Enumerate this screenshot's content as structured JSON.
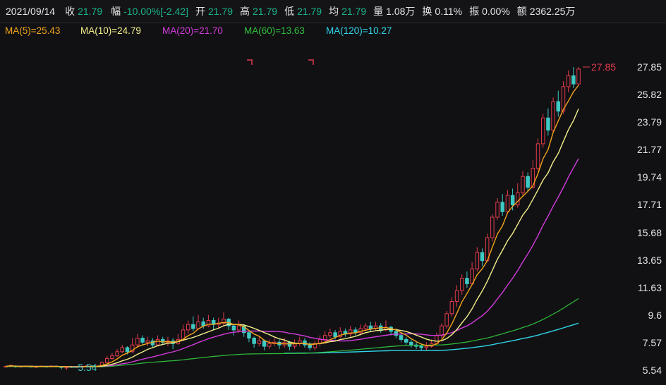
{
  "info": {
    "date": "2021/09/14",
    "close_label": "收",
    "close": "21.79",
    "range_label": "幅",
    "range": "-10.00%[-2.42]",
    "open_label": "开",
    "open": "21.79",
    "high_label": "高",
    "high": "21.79",
    "low_label": "低",
    "low": "21.79",
    "avg_label": "均",
    "avg": "21.79",
    "vol_label": "量",
    "vol": "1.08万",
    "turnover_label": "换",
    "turnover": "0.11%",
    "amp_label": "振",
    "amp": "0.00%",
    "amount_label": "额",
    "amount": "2362.25万"
  },
  "ma": {
    "ma5": "MA(5)=25.43",
    "ma10": "MA(10)=24.79",
    "ma20": "MA(20)=21.70",
    "ma60": "MA(60)=13.63",
    "ma120": "MA(120)=10.27"
  },
  "colors": {
    "up": "#e23a4a",
    "down": "#3ec9c3",
    "ma5": "#f2a51a",
    "ma10": "#f5f08a",
    "ma20": "#d33cdb",
    "ma60": "#2fbf3a",
    "ma120": "#30d6e8",
    "value_green": "#19b38a"
  },
  "y_axis": [
    "27.85",
    "25.82",
    "23.79",
    "21.77",
    "19.74",
    "17.71",
    "15.68",
    "13.65",
    "11.63",
    "9.6",
    "7.57",
    "5.54"
  ],
  "markers": {
    "high": "27.85",
    "low": "5.54"
  },
  "chart_data": {
    "type": "candlestick",
    "ylim": [
      5.54,
      27.85
    ],
    "candles": [
      [
        5.82,
        5.82,
        5.82,
        5.8
      ],
      [
        5.8,
        5.9,
        5.92,
        5.76
      ],
      [
        5.85,
        5.78,
        5.9,
        5.72
      ],
      [
        5.78,
        5.82,
        5.86,
        5.74
      ],
      [
        5.8,
        5.84,
        5.88,
        5.76
      ],
      [
        5.82,
        5.78,
        5.86,
        5.74
      ],
      [
        5.78,
        5.8,
        5.84,
        5.72
      ],
      [
        5.8,
        5.84,
        5.88,
        5.76
      ],
      [
        5.82,
        5.8,
        5.86,
        5.74
      ],
      [
        5.8,
        5.84,
        5.9,
        5.76
      ],
      [
        5.84,
        5.82,
        5.88,
        5.76
      ],
      [
        5.8,
        5.74,
        5.84,
        5.6
      ],
      [
        5.74,
        5.76,
        5.82,
        5.54
      ],
      [
        5.76,
        5.8,
        5.86,
        5.7
      ],
      [
        5.8,
        5.78,
        5.84,
        5.72
      ],
      [
        5.78,
        5.82,
        5.88,
        5.74
      ],
      [
        5.82,
        5.86,
        5.92,
        5.78
      ],
      [
        5.86,
        5.82,
        5.9,
        5.76
      ],
      [
        5.82,
        5.84,
        5.9,
        5.78
      ],
      [
        5.84,
        6.1,
        6.2,
        5.8
      ],
      [
        6.1,
        6.4,
        6.6,
        6.0
      ],
      [
        6.4,
        6.6,
        6.8,
        6.3
      ],
      [
        6.6,
        6.9,
        7.1,
        6.5
      ],
      [
        6.9,
        7.2,
        7.4,
        6.8
      ],
      [
        7.2,
        6.9,
        7.3,
        6.7
      ],
      [
        6.9,
        7.4,
        7.9,
        6.8
      ],
      [
        7.4,
        7.9,
        8.2,
        7.2
      ],
      [
        7.9,
        7.6,
        8.1,
        7.4
      ],
      [
        7.6,
        7.7,
        8.0,
        7.3
      ],
      [
        7.7,
        7.4,
        7.9,
        7.2
      ],
      [
        7.4,
        7.8,
        8.1,
        7.3
      ],
      [
        7.8,
        7.6,
        8.0,
        7.4
      ],
      [
        7.6,
        7.7,
        8.0,
        7.3
      ],
      [
        7.7,
        7.5,
        7.9,
        7.1
      ],
      [
        7.5,
        7.8,
        8.2,
        7.4
      ],
      [
        7.8,
        8.5,
        8.9,
        7.7
      ],
      [
        8.5,
        8.9,
        9.2,
        8.2
      ],
      [
        8.9,
        8.6,
        9.5,
        8.4
      ],
      [
        8.6,
        9.1,
        9.6,
        8.5
      ],
      [
        9.1,
        8.8,
        9.4,
        8.6
      ],
      [
        8.8,
        9.2,
        9.6,
        8.7
      ],
      [
        9.2,
        8.9,
        9.4,
        8.5
      ],
      [
        8.9,
        9.0,
        9.4,
        8.6
      ],
      [
        9.0,
        9.3,
        9.8,
        8.8
      ],
      [
        9.3,
        8.8,
        9.4,
        8.5
      ],
      [
        8.8,
        8.5,
        8.9,
        8.1
      ],
      [
        8.5,
        8.8,
        9.2,
        8.3
      ],
      [
        8.8,
        8.3,
        8.9,
        8.0
      ],
      [
        8.3,
        7.9,
        8.4,
        7.6
      ],
      [
        7.9,
        7.5,
        8.0,
        7.2
      ],
      [
        7.5,
        7.7,
        8.0,
        7.3
      ],
      [
        7.7,
        7.3,
        7.8,
        7.0
      ],
      [
        7.3,
        7.5,
        7.8,
        7.1
      ],
      [
        7.5,
        7.6,
        7.9,
        7.3
      ],
      [
        7.6,
        7.4,
        7.8,
        7.1
      ],
      [
        7.4,
        7.6,
        7.9,
        7.2
      ],
      [
        7.6,
        7.3,
        7.7,
        7.0
      ],
      [
        7.3,
        7.5,
        7.8,
        7.1
      ],
      [
        7.5,
        7.7,
        8.0,
        7.3
      ],
      [
        7.7,
        7.4,
        7.9,
        7.2
      ],
      [
        7.4,
        7.2,
        7.6,
        7.0
      ],
      [
        7.2,
        7.5,
        7.7,
        7.0
      ],
      [
        7.5,
        7.8,
        8.1,
        7.3
      ],
      [
        7.8,
        8.1,
        8.4,
        7.6
      ],
      [
        8.1,
        8.3,
        8.6,
        7.9
      ],
      [
        8.3,
        8.0,
        8.5,
        7.8
      ],
      [
        8.0,
        8.4,
        8.7,
        7.9
      ],
      [
        8.4,
        8.2,
        8.6,
        8.0
      ],
      [
        8.2,
        8.5,
        8.8,
        8.0
      ],
      [
        8.5,
        8.3,
        8.7,
        8.1
      ],
      [
        8.3,
        8.6,
        8.9,
        8.1
      ],
      [
        8.6,
        8.8,
        9.0,
        8.4
      ],
      [
        8.8,
        8.6,
        9.1,
        8.4
      ],
      [
        8.6,
        8.8,
        9.1,
        8.5
      ],
      [
        8.8,
        8.5,
        9.0,
        8.3
      ],
      [
        8.5,
        8.7,
        9.2,
        8.4
      ],
      [
        8.7,
        8.4,
        8.8,
        8.1
      ],
      [
        8.4,
        8.1,
        8.6,
        7.9
      ],
      [
        8.1,
        7.8,
        8.3,
        7.6
      ],
      [
        7.8,
        7.6,
        8.0,
        7.4
      ],
      [
        7.6,
        7.4,
        7.8,
        7.2
      ],
      [
        7.4,
        7.3,
        7.6,
        7.1
      ],
      [
        7.3,
        7.2,
        7.5,
        7.0
      ],
      [
        7.2,
        7.3,
        7.6,
        7.0
      ],
      [
        7.3,
        7.5,
        7.8,
        7.2
      ],
      [
        7.5,
        8.1,
        8.3,
        7.4
      ],
      [
        8.1,
        8.8,
        9.0,
        7.9
      ],
      [
        8.8,
        9.7,
        9.9,
        8.6
      ],
      [
        9.7,
        10.6,
        10.9,
        9.5
      ],
      [
        10.6,
        11.4,
        11.8,
        10.2
      ],
      [
        11.4,
        12.3,
        12.6,
        11.1
      ],
      [
        12.3,
        11.9,
        12.8,
        11.6
      ],
      [
        11.9,
        13.0,
        13.5,
        11.8
      ],
      [
        13.0,
        14.2,
        14.6,
        12.8
      ],
      [
        14.2,
        13.6,
        14.5,
        13.2
      ],
      [
        13.6,
        15.3,
        15.6,
        13.5
      ],
      [
        15.3,
        16.8,
        17.0,
        15.0
      ],
      [
        16.8,
        17.9,
        18.2,
        16.6
      ],
      [
        17.9,
        17.2,
        18.5,
        16.9
      ],
      [
        17.2,
        18.4,
        18.8,
        17.0
      ],
      [
        18.4,
        17.7,
        18.9,
        17.3
      ],
      [
        17.7,
        18.6,
        19.3,
        17.5
      ],
      [
        18.6,
        19.8,
        20.2,
        18.4
      ],
      [
        19.8,
        19.0,
        20.1,
        18.7
      ],
      [
        19.0,
        20.4,
        21.0,
        18.9
      ],
      [
        20.4,
        22.2,
        22.6,
        20.2
      ],
      [
        22.2,
        24.1,
        24.4,
        21.9
      ],
      [
        24.1,
        23.2,
        24.8,
        22.8
      ],
      [
        23.2,
        25.3,
        25.6,
        23.0
      ],
      [
        25.3,
        24.6,
        26.1,
        24.2
      ],
      [
        24.6,
        26.4,
        26.8,
        24.4
      ],
      [
        26.4,
        27.2,
        27.6,
        26.0
      ],
      [
        27.2,
        26.6,
        27.85,
        26.3
      ],
      [
        26.6,
        27.7,
        27.85,
        26.5
      ]
    ]
  }
}
